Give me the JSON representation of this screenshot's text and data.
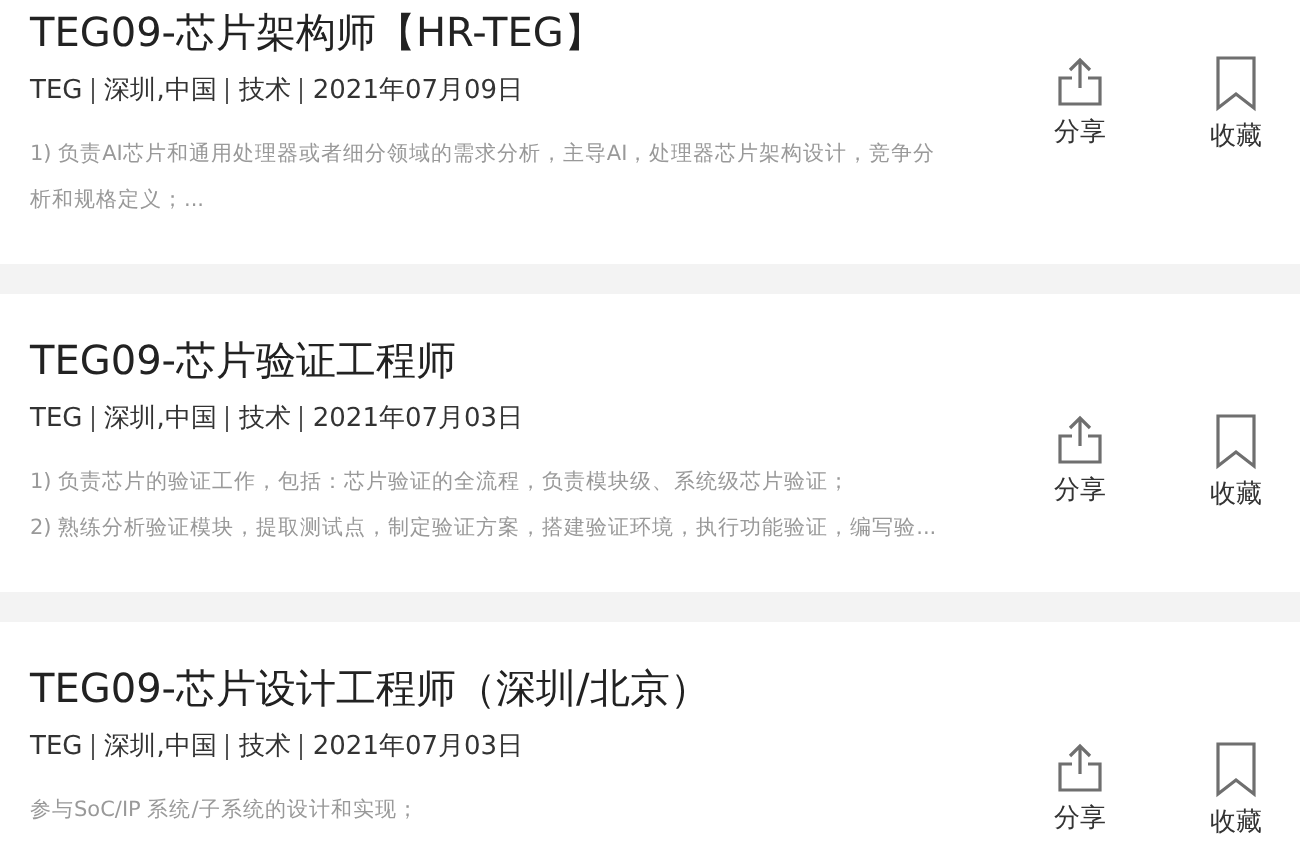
{
  "jobs": [
    {
      "title": "TEG09-芯片架构师【HR-TEG】",
      "meta": [
        "TEG",
        "深圳,中国",
        "技术",
        "2021年07月09日"
      ],
      "description": [
        "1) 负责AI芯片和通用处理器或者细分领域的需求分析，主导AI，处理器芯片架构设计，竞争分",
        "析和规格定义；..."
      ],
      "share_label": "分享",
      "bookmark_label": "收藏"
    },
    {
      "title": "TEG09-芯片验证工程师",
      "meta": [
        "TEG",
        "深圳,中国",
        "技术",
        "2021年07月03日"
      ],
      "description": [
        "1) 负责芯片的验证工作，包括：芯片验证的全流程，负责模块级、系统级芯片验证；",
        "2) 熟练分析验证模块，提取测试点，制定验证方案，搭建验证环境，执行功能验证，编写验..."
      ],
      "share_label": "分享",
      "bookmark_label": "收藏"
    },
    {
      "title": "TEG09-芯片设计工程师（深圳/北京）",
      "meta": [
        "TEG",
        "深圳,中国",
        "技术",
        "2021年07月03日"
      ],
      "description": [
        "参与SoC/IP 系统/子系统的设计和实现；"
      ],
      "share_label": "分享",
      "bookmark_label": "收藏"
    }
  ]
}
